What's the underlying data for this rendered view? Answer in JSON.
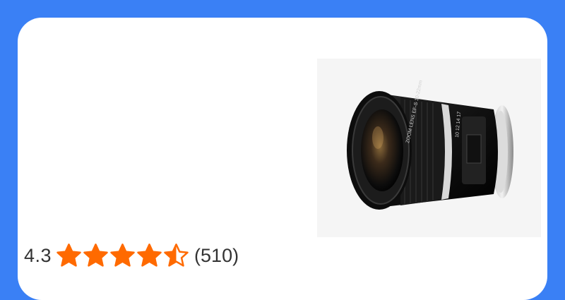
{
  "product": {
    "image_icon": "camera-lens-image"
  },
  "rating": {
    "value": "4.3",
    "stars_filled": 4.5,
    "stars_total": 5,
    "review_count": "(510)",
    "star_color": "#ff6a00"
  },
  "colors": {
    "background": "#3a80f5",
    "card": "#ffffff"
  }
}
